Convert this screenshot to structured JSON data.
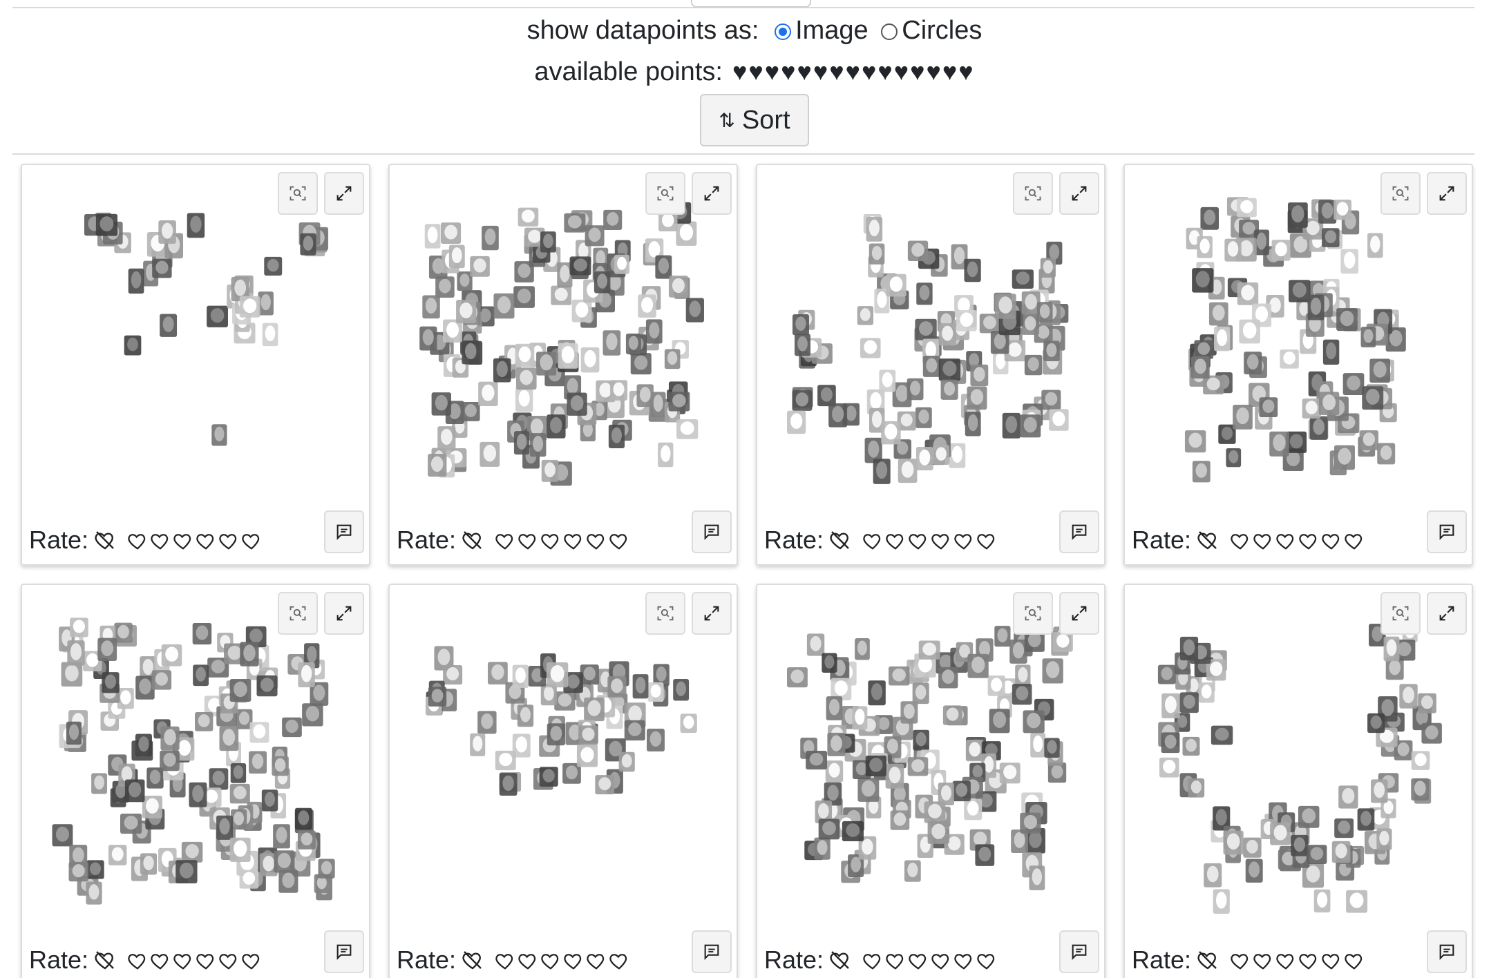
{
  "controls": {
    "show_label": "show datapoints as:",
    "option_image": "Image",
    "option_circles": "Circles",
    "selected": "Image",
    "available_label": "available points:",
    "available_hearts": "♥♥♥♥♥♥♥♥♥♥♥♥♥♥♥",
    "sort_label": "Sort"
  },
  "card_common": {
    "rate_label": "Rate:",
    "max_hearts": 6
  },
  "cards": [
    {
      "shape": "scattered"
    },
    {
      "shape": "blob"
    },
    {
      "shape": "arrow"
    },
    {
      "shape": "vertical"
    },
    {
      "shape": "cloud"
    },
    {
      "shape": "band"
    },
    {
      "shape": "wide"
    },
    {
      "shape": "u-curve"
    }
  ],
  "colors": {
    "accent": "#1a73e8",
    "border": "#dcdcdc",
    "text": "#212529"
  }
}
